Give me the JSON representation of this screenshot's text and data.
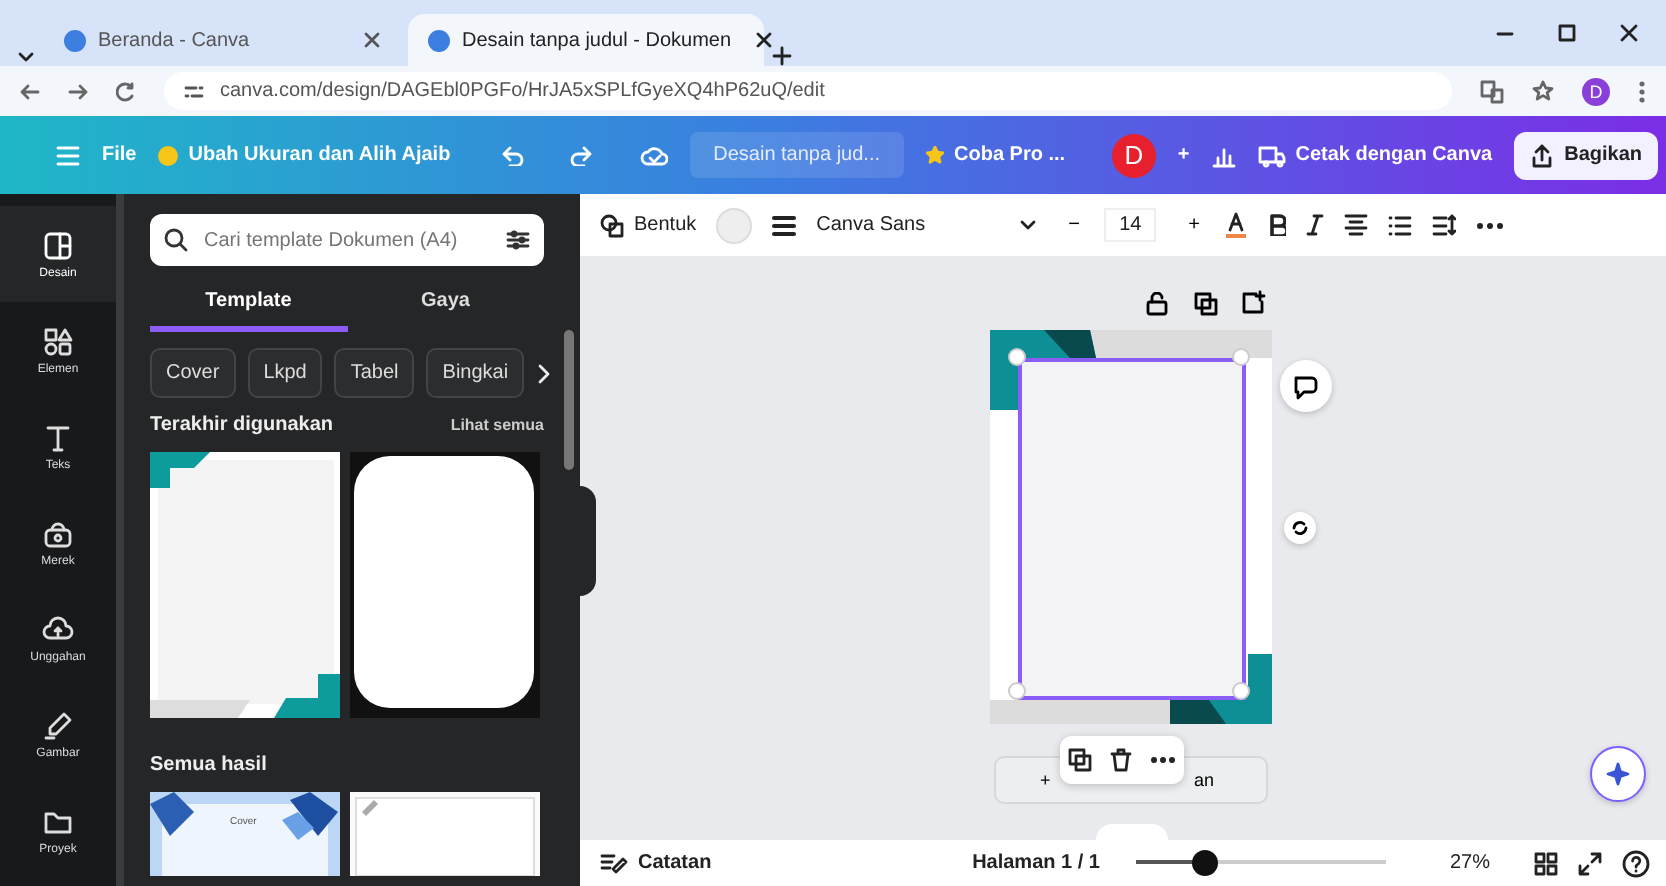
{
  "browser": {
    "tabs": [
      {
        "title": "Beranda - Canva",
        "selected": false
      },
      {
        "title": "Desain tanpa judul - Dokumen",
        "selected": true
      }
    ],
    "url": "canva.com/design/DAGEbl0PGFo/HrJA5xSPLfGyeXQ4hP62uQ/edit",
    "profile": "D"
  },
  "header": {
    "file": "File",
    "resize": "Ubah Ukuran dan Alih Ajaib",
    "doc_title": "Desain tanpa jud...",
    "pro": "Coba Pro ...",
    "avatar": "D",
    "add": "+",
    "print": "Cetak dengan Canva",
    "share": "Bagikan"
  },
  "rail": [
    {
      "kind": "design",
      "label": "Desain",
      "selected": true
    },
    {
      "kind": "elements",
      "label": "Elemen",
      "selected": false
    },
    {
      "kind": "text",
      "label": "Teks",
      "selected": false
    },
    {
      "kind": "brand",
      "label": "Merek",
      "selected": false
    },
    {
      "kind": "uploads",
      "label": "Unggahan",
      "selected": false
    },
    {
      "kind": "draw",
      "label": "Gambar",
      "selected": false
    },
    {
      "kind": "projects",
      "label": "Proyek",
      "selected": false
    }
  ],
  "panel": {
    "search": {
      "placeholder": "Cari template Dokumen (A4)"
    },
    "tabs": [
      {
        "label": "Template",
        "selected": true
      },
      {
        "label": "Gaya",
        "selected": false
      }
    ],
    "chips": [
      "Cover",
      "Lkpd",
      "Tabel",
      "Bingkai"
    ],
    "recent": {
      "title": "Terakhir digunakan",
      "see_all": "Lihat semua",
      "items": [
        {
          "kind": "teal-corners"
        },
        {
          "kind": "rounded-frame"
        }
      ]
    },
    "results": {
      "title": "Semua hasil",
      "items": [
        {
          "kind": "blue-cover",
          "caption": "Cover"
        },
        {
          "kind": "plain"
        }
      ]
    }
  },
  "toolbar": {
    "shape": "Bentuk",
    "font": "Canva Sans",
    "minus": "−",
    "size": "14",
    "plus": "+"
  },
  "canvas": {
    "add_page": {
      "start": "+",
      "end": "an"
    }
  },
  "footer": {
    "notes": "Catatan",
    "page": "Halaman 1 / 1",
    "zoom": {
      "level": 0.27
    },
    "zoom_text": "27%"
  }
}
